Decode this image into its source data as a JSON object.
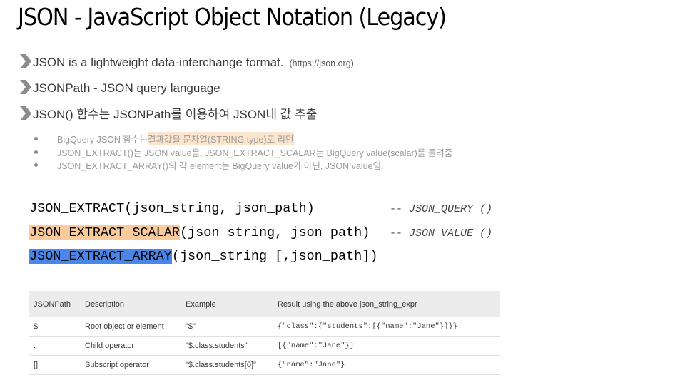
{
  "title": "JSON - JavaScript Object Notation (Legacy)",
  "bullets": [
    {
      "text": "JSON is a lightweight data-interchange format.",
      "note": "(https://json.org)"
    },
    {
      "text": "JSONPath - JSON query language"
    },
    {
      "text": "JSON() 함수는 JSONPath를 이용하여 JSON내 값 추출"
    }
  ],
  "sub_bullets": {
    "b1_prefix": "BigQuery JSON 함수는 ",
    "b1_highlight": "결과값을 문자열(STRING type)로 리턴",
    "b2": "JSON_EXTRACT()는 JSON value를, JSON_EXTRACT_SCALAR는 BigQuery value(scalar)를 돌려줌",
    "b3": "JSON_EXTRACT_ARRAY()의 각 element는 BigQuery value가 아닌, JSON value임."
  },
  "code": {
    "line1": "JSON_EXTRACT(json_string, json_path)",
    "line1_comment": "-- JSON_QUERY ()",
    "line2_func": "JSON_EXTRACT_SCALAR",
    "line2_args": "(json_string, json_path)",
    "line2_comment": "-- JSON_VALUE ()",
    "line3_func": "JSON_EXTRACT_ARRAY",
    "line3_args": "(json_string [,json_path])"
  },
  "table": {
    "headers": [
      "JSONPath",
      "Description",
      "Example",
      "Result using the above json_string_expr"
    ],
    "rows": [
      [
        "$",
        "Root object or element",
        "\"$\"",
        "{\"class\":{\"students\":[{\"name\":\"Jane\"}]}}"
      ],
      [
        ".",
        "Child operator",
        "\"$.class.students\"",
        "[{\"name\":\"Jane\"}]"
      ],
      [
        "[]",
        "Subscript operator",
        "\"$.class.students[0]\"",
        "{\"name\":\"Jane\"}"
      ]
    ]
  },
  "colors": {
    "highlight_orange": "#f9cb9c",
    "highlight_light_orange": "#fce5cd",
    "highlight_blue": "#4a86e8",
    "chevron": "#8c8c8c"
  }
}
